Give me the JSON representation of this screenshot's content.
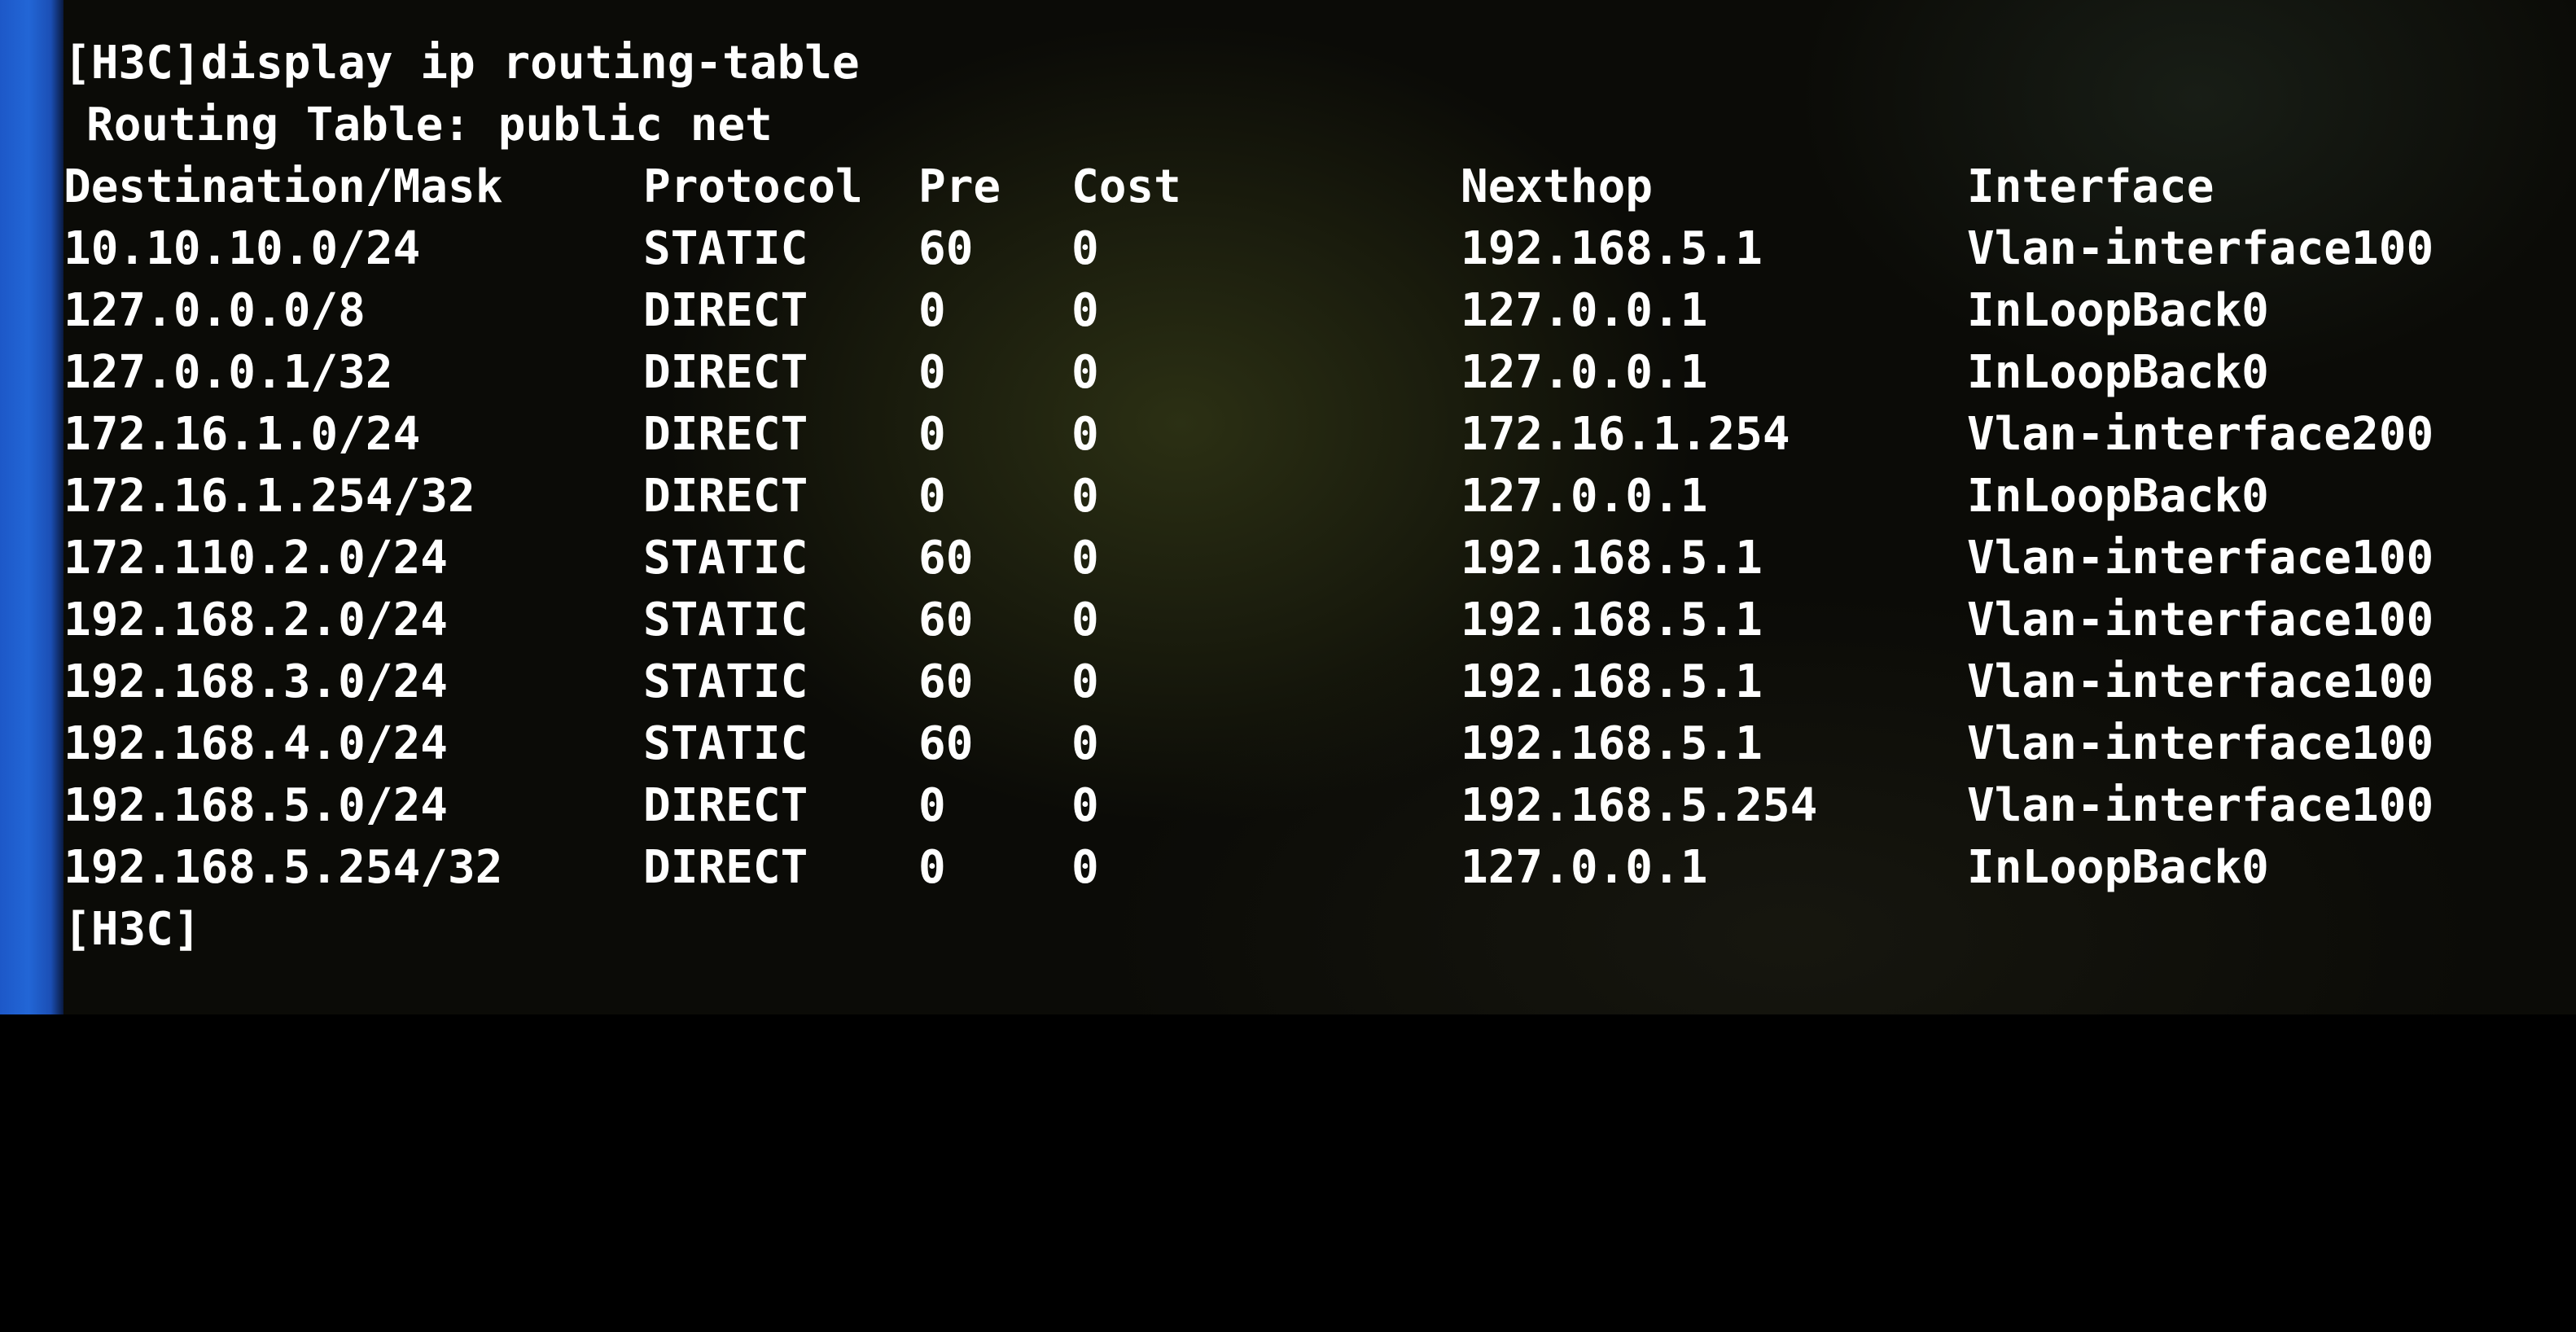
{
  "terminal": {
    "command_line": "[H3C]display ip routing-table",
    "table_title": "Routing Table: public net",
    "headers": {
      "destination": "Destination/Mask",
      "protocol": "Protocol",
      "pre": "Pre",
      "cost": "Cost",
      "nexthop": "Nexthop",
      "interface": "Interface"
    },
    "rows": [
      {
        "destination": "10.10.10.0/24",
        "protocol": "STATIC",
        "pre": "60",
        "cost": "0",
        "nexthop": "192.168.5.1",
        "interface": "Vlan-interface100"
      },
      {
        "destination": "127.0.0.0/8",
        "protocol": "DIRECT",
        "pre": "0",
        "cost": "0",
        "nexthop": "127.0.0.1",
        "interface": "InLoopBack0"
      },
      {
        "destination": "127.0.0.1/32",
        "protocol": "DIRECT",
        "pre": "0",
        "cost": "0",
        "nexthop": "127.0.0.1",
        "interface": "InLoopBack0"
      },
      {
        "destination": "172.16.1.0/24",
        "protocol": "DIRECT",
        "pre": "0",
        "cost": "0",
        "nexthop": "172.16.1.254",
        "interface": "Vlan-interface200"
      },
      {
        "destination": "172.16.1.254/32",
        "protocol": "DIRECT",
        "pre": "0",
        "cost": "0",
        "nexthop": "127.0.0.1",
        "interface": "InLoopBack0"
      },
      {
        "destination": "172.110.2.0/24",
        "protocol": "STATIC",
        "pre": "60",
        "cost": "0",
        "nexthop": "192.168.5.1",
        "interface": "Vlan-interface100"
      },
      {
        "destination": "192.168.2.0/24",
        "protocol": "STATIC",
        "pre": "60",
        "cost": "0",
        "nexthop": "192.168.5.1",
        "interface": "Vlan-interface100"
      },
      {
        "destination": "192.168.3.0/24",
        "protocol": "STATIC",
        "pre": "60",
        "cost": "0",
        "nexthop": "192.168.5.1",
        "interface": "Vlan-interface100"
      },
      {
        "destination": "192.168.4.0/24",
        "protocol": "STATIC",
        "pre": "60",
        "cost": "0",
        "nexthop": "192.168.5.1",
        "interface": "Vlan-interface100"
      },
      {
        "destination": "192.168.5.0/24",
        "protocol": "DIRECT",
        "pre": "0",
        "cost": "0",
        "nexthop": "192.168.5.254",
        "interface": "Vlan-interface100"
      },
      {
        "destination": "192.168.5.254/32",
        "protocol": "DIRECT",
        "pre": "0",
        "cost": "0",
        "nexthop": "127.0.0.1",
        "interface": "InLoopBack0"
      }
    ],
    "prompt": "[H3C]"
  },
  "colors": {
    "text": "#ffffff",
    "background": "#000000",
    "window_edge": "#2266d6"
  }
}
